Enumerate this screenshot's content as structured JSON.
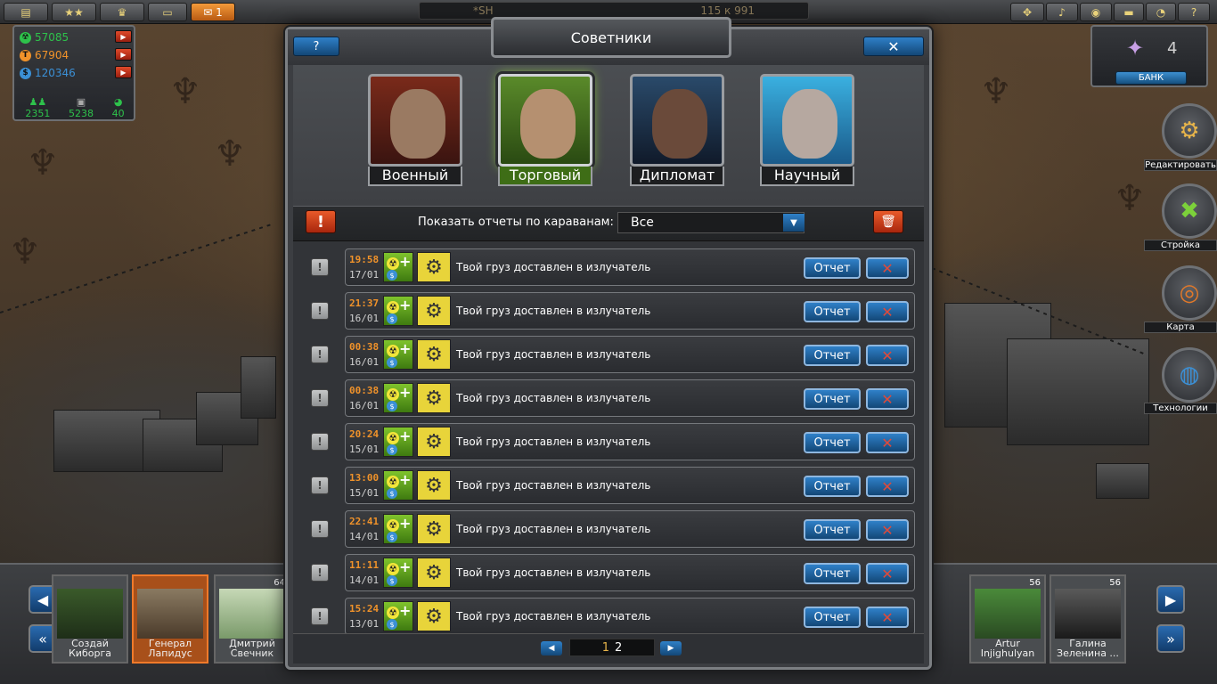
{
  "topbar": {
    "mail_count": "1",
    "center_left": "*SH",
    "center_right": "115 к 991"
  },
  "resources": [
    {
      "value": "57085",
      "color": "#2ec24b",
      "icon": "nuclear-icon"
    },
    {
      "value": "67904",
      "color": "#f0922a",
      "icon": "titanium-icon"
    },
    {
      "value": "120346",
      "color": "#3b90d6",
      "icon": "dollar-icon"
    }
  ],
  "units": [
    "2351",
    "5238",
    "40"
  ],
  "bank": {
    "crystals": "4",
    "label": "БАНК"
  },
  "side_buttons": [
    {
      "label": "Редактировать",
      "icon": "gear-icon"
    },
    {
      "label": "Стройка",
      "icon": "wrench-icon"
    },
    {
      "label": "Карта",
      "icon": "map-icon"
    },
    {
      "label": "Технологии",
      "icon": "globe-icon"
    }
  ],
  "friends": [
    {
      "name": "Создай\nКиборга",
      "level": ""
    },
    {
      "name": "Генерал\nЛапидус",
      "level": ""
    },
    {
      "name": "Дмитрий\nСвечник",
      "level": "64"
    },
    {
      "name": "Artur\nInjighulyan",
      "level": "56"
    },
    {
      "name": "Галина\nЗеленина ...",
      "level": "56"
    }
  ],
  "modal": {
    "title": "Советники",
    "help": "?",
    "close": "✕",
    "advisors": [
      {
        "label": "Военный",
        "active": false
      },
      {
        "label": "Торговый",
        "active": true
      },
      {
        "label": "Дипломат",
        "active": false
      },
      {
        "label": "Научный",
        "active": false
      }
    ],
    "filter_label": "Показать отчеты по караванам:",
    "filter_value": "Все",
    "report_label": "Отчет",
    "message": "Твой груз доставлен в излучатель",
    "reports": [
      {
        "time": "19:58",
        "date": "17/01"
      },
      {
        "time": "21:37",
        "date": "16/01"
      },
      {
        "time": "00:38",
        "date": "16/01"
      },
      {
        "time": "00:38",
        "date": "16/01"
      },
      {
        "time": "20:24",
        "date": "15/01"
      },
      {
        "time": "13:00",
        "date": "15/01"
      },
      {
        "time": "22:41",
        "date": "14/01"
      },
      {
        "time": "11:11",
        "date": "14/01"
      },
      {
        "time": "15:24",
        "date": "13/01"
      }
    ],
    "pages": {
      "current": "1",
      "other": "2"
    }
  }
}
